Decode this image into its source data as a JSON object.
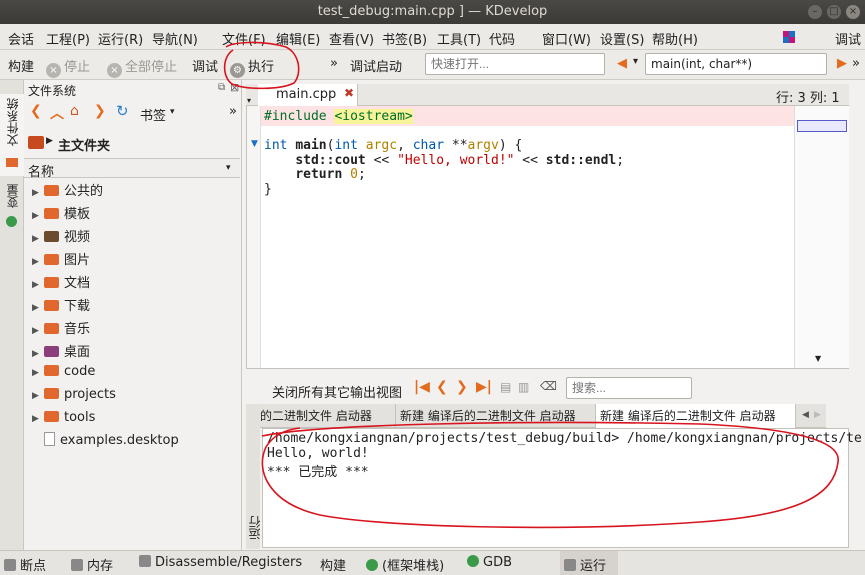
{
  "window": {
    "title": "test_debug:main.cpp ] — KDevelop"
  },
  "menubar": {
    "items": [
      "会话",
      "工程(P)",
      "运行(R)",
      "导航(N)",
      "文件(F)",
      "编辑(E)",
      "查看(V)",
      "书签(B)",
      "工具(T)",
      "代码",
      "窗口(W)",
      "设置(S)",
      "帮助(H)"
    ],
    "right_label": "调试"
  },
  "toolbar": {
    "build": "构建",
    "stop": "停止",
    "stop_all": "全部停止",
    "debug": "调试",
    "execute": "执行",
    "debug_launch": "调试启动",
    "quick_open_placeholder": "快速打开...",
    "context": "main(int, char**)"
  },
  "left_tabs": {
    "filesystem": "文件系统",
    "variables": "变量"
  },
  "fs_panel": {
    "title": "文件系统",
    "bookmarks": "书签",
    "home": "主文件夹",
    "column": "名称",
    "items": [
      {
        "name": "公共的",
        "icon": "folder"
      },
      {
        "name": "模板",
        "icon": "folder"
      },
      {
        "name": "视频",
        "icon": "folder-dark"
      },
      {
        "name": "图片",
        "icon": "folder"
      },
      {
        "name": "文档",
        "icon": "folder"
      },
      {
        "name": "下载",
        "icon": "folder"
      },
      {
        "name": "音乐",
        "icon": "folder"
      },
      {
        "name": "桌面",
        "icon": "folder-purple"
      },
      {
        "name": "code",
        "icon": "folder"
      },
      {
        "name": "projects",
        "icon": "folder"
      },
      {
        "name": "tools",
        "icon": "folder"
      },
      {
        "name": "examples.desktop",
        "icon": "file"
      }
    ]
  },
  "editor": {
    "tab": "main.cpp",
    "position": "行: 3 列: 1",
    "lines": [
      "#include <iostream>",
      "",
      "int main(int argc, char **argv) {",
      "    std::cout << \"Hello, world!\" << std::endl;",
      "    return 0;",
      "}"
    ]
  },
  "output": {
    "close_others": "关闭所有其它输出视图",
    "search_placeholder": "搜索...",
    "tabs": [
      "的二进制文件 启动器",
      "新建 编译后的二进制文件 启动器",
      "新建 编译后的二进制文件 启动器"
    ],
    "lines": [
      "/home/kongxiangnan/projects/test_debug/build> /home/kongxiangnan/projects/te",
      "Hello, world!",
      "*** 已完成 ***"
    ],
    "side_label": "运行"
  },
  "statusbar": {
    "items": [
      "断点",
      "内存",
      "Disassemble/Registers",
      "构建",
      "(框架堆栈)",
      "GDB",
      "运行"
    ]
  },
  "colors": {
    "annotation": "#d8141e",
    "accent_orange": "#e36b1e"
  }
}
